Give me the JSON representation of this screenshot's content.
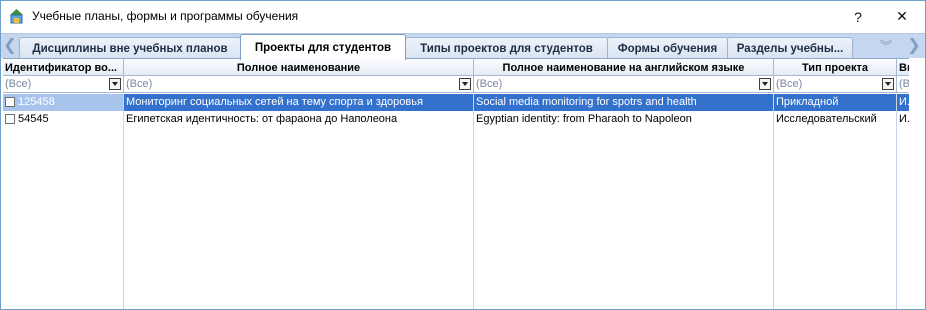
{
  "window": {
    "title": "Учебные планы, формы и программы обучения",
    "help_label": "?",
    "close_label": "✕"
  },
  "tabs": [
    {
      "label": "Дисциплины вне учебных планов",
      "active": false
    },
    {
      "label": "Проекты для студентов",
      "active": true
    },
    {
      "label": "Типы проектов для студентов",
      "active": false
    },
    {
      "label": "Формы обучения",
      "active": false
    },
    {
      "label": "Разделы учебны...",
      "active": false
    }
  ],
  "tab_controls": {
    "left_arrow": "❮",
    "right_arrow": "❯",
    "menu_chevron": "︾"
  },
  "grid": {
    "columns": [
      {
        "header": "Идентификатор во...",
        "filter": "(Все)"
      },
      {
        "header": "Полное наименование",
        "filter": "(Все)"
      },
      {
        "header": "Полное наименование на английском языке",
        "filter": "(Все)"
      },
      {
        "header": "Тип проекта",
        "filter": "(Все)"
      },
      {
        "header": "Ви",
        "filter": "(Вс"
      }
    ],
    "rows": [
      {
        "id": "125458",
        "name": "Мониторинг социальных сетей на тему спорта и здоровья",
        "name_en": "Social media monitoring for spotrs and health",
        "type": "Прикладной",
        "extra": "И..",
        "selected": true
      },
      {
        "id": "54545",
        "name": "Египетская идентичность: от фараона до Наполеона",
        "name_en": "Egyptian identity: from Pharaoh to Napoleon",
        "type": "Исследовательский",
        "extra": "И..",
        "selected": false
      }
    ]
  },
  "colors": {
    "selection": "#3371cc",
    "tabstrip": "#c5d7ee",
    "border": "#6f9fc9"
  }
}
